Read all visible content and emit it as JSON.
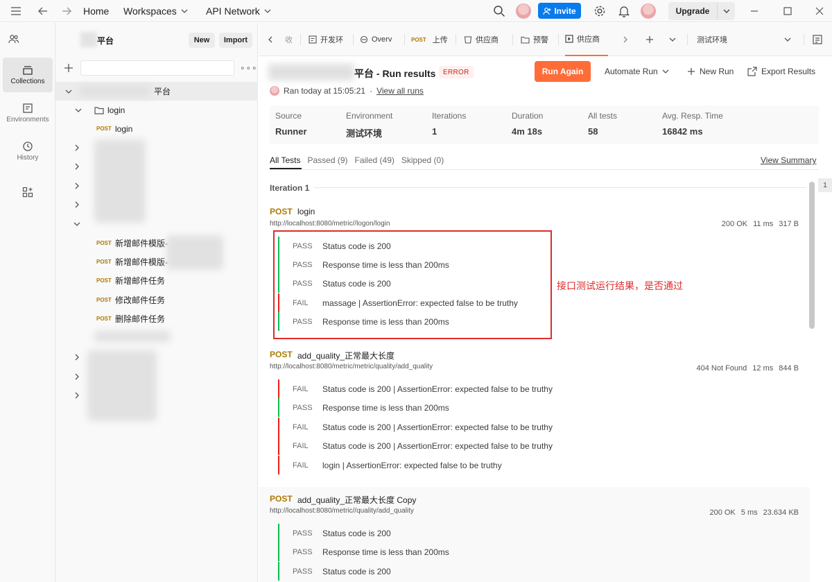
{
  "topbar": {
    "home": "Home",
    "workspaces": "Workspaces",
    "api_network": "API Network",
    "invite": "Invite",
    "upgrade": "Upgrade"
  },
  "rail": {
    "items": [
      {
        "label": "Collections",
        "icon": "collections-icon"
      },
      {
        "label": "Environments",
        "icon": "environments-icon"
      },
      {
        "label": "History",
        "icon": "history-icon"
      }
    ]
  },
  "sidebar": {
    "workspace_name_suffix": "平台",
    "new": "New",
    "import": "Import",
    "collection_suffix": "平台",
    "folder_login": "login",
    "method_post": "POST",
    "request_login": "login",
    "requests": [
      "新增邮件模版-",
      "新增邮件模版-",
      "新增邮件任务",
      "修改邮件任务",
      "删除邮件任务"
    ]
  },
  "tabs": {
    "items": [
      {
        "label": "开发环"
      },
      {
        "label": "Overv"
      },
      {
        "label": "上传",
        "method": "POST"
      },
      {
        "label": "供应商"
      },
      {
        "label": "预警"
      },
      {
        "label": "供应商"
      }
    ],
    "environment": "测试环境"
  },
  "run": {
    "title_suffix": "平台 - Run results",
    "status_badge": "ERROR",
    "run_again": "Run Again",
    "automate_run": "Automate Run",
    "new_run": "New Run",
    "export_results": "Export Results",
    "ran_text": "Ran today at 15:05:21",
    "dot": "·",
    "view_all_runs": "View all runs",
    "summary": [
      {
        "label": "Source",
        "value": "Runner"
      },
      {
        "label": "Environment",
        "value": "测试环境"
      },
      {
        "label": "Iterations",
        "value": "1"
      },
      {
        "label": "Duration",
        "value": "4m 18s"
      },
      {
        "label": "All tests",
        "value": "58"
      },
      {
        "label": "Avg. Resp. Time",
        "value": "16842 ms"
      }
    ],
    "filters": {
      "all": "All Tests",
      "passed": "Passed (9)",
      "failed": "Failed (49)",
      "skipped": "Skipped (0)"
    },
    "view_summary": "View Summary",
    "iteration": "Iteration 1",
    "side_number": "1"
  },
  "requests": [
    {
      "method": "POST",
      "name": "login",
      "url": "http://localhost:8080/metric//logon/login",
      "status": "200 OK",
      "time": "11 ms",
      "size": "317 B",
      "tests": [
        {
          "status": "PASS",
          "text": "Status code is 200"
        },
        {
          "status": "PASS",
          "text": "Response time is less than 200ms"
        },
        {
          "status": "PASS",
          "text": "Status code is 200"
        },
        {
          "status": "FAIL",
          "text": "massage | AssertionError: expected false to be truthy"
        },
        {
          "status": "PASS",
          "text": "Response time is less than 200ms"
        }
      ]
    },
    {
      "method": "POST",
      "name": "add_quality_正常最大长度",
      "url": "http://localhost:8080/metric/metric/quality/add_quality",
      "status": "404 Not Found",
      "time": "12 ms",
      "size": "844 B",
      "tests": [
        {
          "status": "FAIL",
          "text": "Status code is 200 | AssertionError: expected false to be truthy"
        },
        {
          "status": "PASS",
          "text": "Response time is less than 200ms"
        },
        {
          "status": "FAIL",
          "text": "Status code is 200 | AssertionError: expected false to be truthy"
        },
        {
          "status": "FAIL",
          "text": "Status code is 200 | AssertionError: expected false to be truthy"
        },
        {
          "status": "FAIL",
          "text": "login | AssertionError: expected false to be truthy"
        }
      ]
    },
    {
      "method": "POST",
      "name": "add_quality_正常最大长度 Copy",
      "url": "http://localhost:8080/metric//quality/add_quality",
      "status": "200 OK",
      "time": "5 ms",
      "size": "23.634 KB",
      "tests": [
        {
          "status": "PASS",
          "text": "Status code is 200"
        },
        {
          "status": "PASS",
          "text": "Response time is less than 200ms"
        },
        {
          "status": "PASS",
          "text": "Status code is 200"
        }
      ]
    }
  ],
  "annotation": "接口测试运行结果，是否通过",
  "colors": {
    "accent": "#ff6c37",
    "invite": "#097bed",
    "pass": "#0cbb52",
    "fail": "#eb2013",
    "post": "#ad7a03",
    "annotation": "#e02a2a"
  }
}
